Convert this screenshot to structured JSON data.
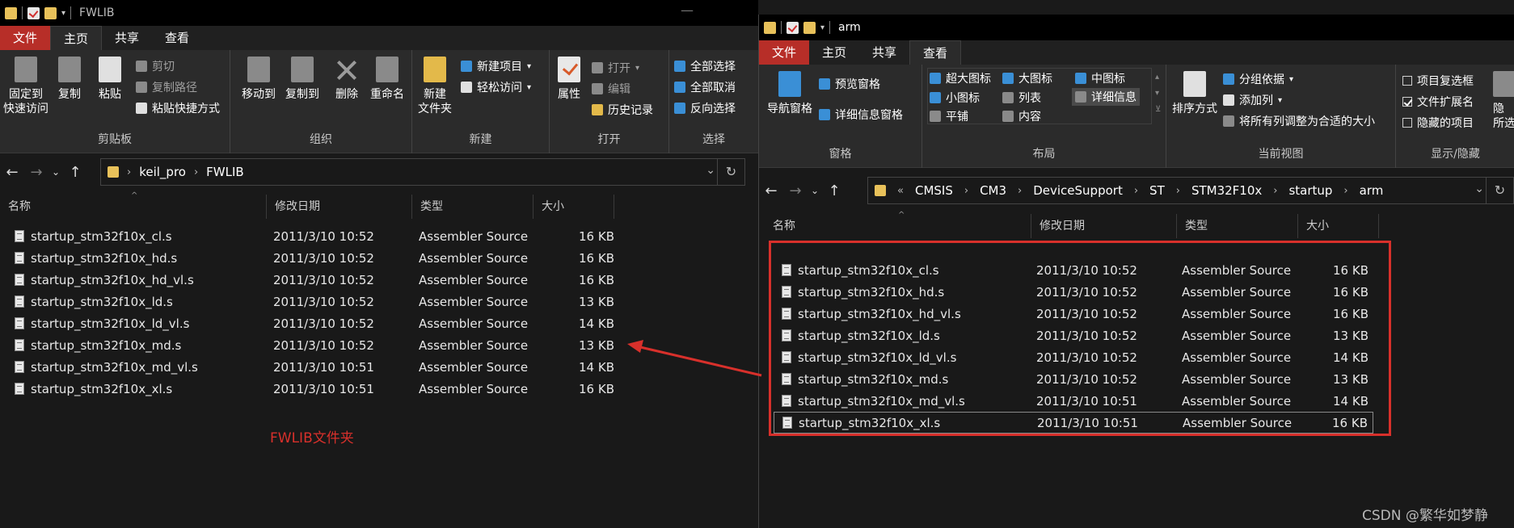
{
  "left": {
    "title": "FWLIB",
    "tabs": [
      "文件",
      "主页",
      "共享",
      "查看"
    ],
    "ribbon": {
      "clipboard": {
        "pin": "固定到\n快速访问",
        "copy": "复制",
        "paste": "粘贴",
        "cut": "剪切",
        "copy_path": "复制路径",
        "paste_shortcut": "粘贴快捷方式",
        "label": "剪贴板"
      },
      "organize": {
        "move_to": "移动到",
        "copy_to": "复制到",
        "delete": "删除",
        "rename": "重命名",
        "label": "组织"
      },
      "new": {
        "new_folder": "新建\n文件夹",
        "new_item": "新建项目",
        "easy_access": "轻松访问",
        "label": "新建"
      },
      "open": {
        "properties": "属性",
        "open": "打开",
        "edit": "编辑",
        "history": "历史记录",
        "label": "打开"
      },
      "select": {
        "select_all": "全部选择",
        "select_none": "全部取消",
        "invert": "反向选择",
        "label": "选择"
      }
    },
    "path": [
      "keil_pro",
      "FWLIB"
    ],
    "columns": [
      "名称",
      "修改日期",
      "类型",
      "大小"
    ],
    "files": [
      {
        "name": "startup_stm32f10x_cl.s",
        "date": "2011/3/10 10:52",
        "type": "Assembler Source",
        "size": "16 KB"
      },
      {
        "name": "startup_stm32f10x_hd.s",
        "date": "2011/3/10 10:52",
        "type": "Assembler Source",
        "size": "16 KB"
      },
      {
        "name": "startup_stm32f10x_hd_vl.s",
        "date": "2011/3/10 10:52",
        "type": "Assembler Source",
        "size": "16 KB"
      },
      {
        "name": "startup_stm32f10x_ld.s",
        "date": "2011/3/10 10:52",
        "type": "Assembler Source",
        "size": "13 KB"
      },
      {
        "name": "startup_stm32f10x_ld_vl.s",
        "date": "2011/3/10 10:52",
        "type": "Assembler Source",
        "size": "14 KB"
      },
      {
        "name": "startup_stm32f10x_md.s",
        "date": "2011/3/10 10:52",
        "type": "Assembler Source",
        "size": "13 KB"
      },
      {
        "name": "startup_stm32f10x_md_vl.s",
        "date": "2011/3/10 10:51",
        "type": "Assembler Source",
        "size": "14 KB"
      },
      {
        "name": "startup_stm32f10x_xl.s",
        "date": "2011/3/10 10:51",
        "type": "Assembler Source",
        "size": "16 KB"
      }
    ],
    "annotation": "FWLIB文件夹"
  },
  "right": {
    "title": "arm",
    "tabs": [
      "文件",
      "主页",
      "共享",
      "查看"
    ],
    "ribbon": {
      "pane": {
        "nav_pane": "导航窗格",
        "preview_pane": "预览窗格",
        "details_pane": "详细信息窗格",
        "label": "窗格"
      },
      "layout": {
        "items": [
          "超大图标",
          "大图标",
          "中图标",
          "小图标",
          "列表",
          "详细信息",
          "平铺",
          "内容"
        ],
        "label": "布局"
      },
      "current_view": {
        "sort_by": "排序方式",
        "group_by": "分组依据",
        "add_columns": "添加列",
        "size_all_columns": "将所有列调整为合适的大小",
        "label": "当前视图"
      },
      "show_hide": {
        "item_checkboxes": "项目复选框",
        "file_extensions": "文件扩展名",
        "hidden_items": "隐藏的项目",
        "hide_selected": "隐",
        "hide_selected_2": "所选",
        "label": "显示/隐藏"
      }
    },
    "path": [
      "«",
      "CMSIS",
      "CM3",
      "DeviceSupport",
      "ST",
      "STM32F10x",
      "startup",
      "arm"
    ],
    "columns": [
      "名称",
      "修改日期",
      "类型",
      "大小"
    ],
    "files": [
      {
        "name": "startup_stm32f10x_cl.s",
        "date": "2011/3/10 10:52",
        "type": "Assembler Source",
        "size": "16 KB"
      },
      {
        "name": "startup_stm32f10x_hd.s",
        "date": "2011/3/10 10:52",
        "type": "Assembler Source",
        "size": "16 KB"
      },
      {
        "name": "startup_stm32f10x_hd_vl.s",
        "date": "2011/3/10 10:52",
        "type": "Assembler Source",
        "size": "16 KB"
      },
      {
        "name": "startup_stm32f10x_ld.s",
        "date": "2011/3/10 10:52",
        "type": "Assembler Source",
        "size": "13 KB"
      },
      {
        "name": "startup_stm32f10x_ld_vl.s",
        "date": "2011/3/10 10:52",
        "type": "Assembler Source",
        "size": "14 KB"
      },
      {
        "name": "startup_stm32f10x_md.s",
        "date": "2011/3/10 10:52",
        "type": "Assembler Source",
        "size": "13 KB"
      },
      {
        "name": "startup_stm32f10x_md_vl.s",
        "date": "2011/3/10 10:51",
        "type": "Assembler Source",
        "size": "14 KB"
      },
      {
        "name": "startup_stm32f10x_xl.s",
        "date": "2011/3/10 10:51",
        "type": "Assembler Source",
        "size": "16 KB"
      }
    ]
  },
  "watermark": "CSDN @繁华如梦静",
  "colors": {
    "file_tab": "#b72e28",
    "annotation": "#d8302b",
    "background": "#191919"
  }
}
